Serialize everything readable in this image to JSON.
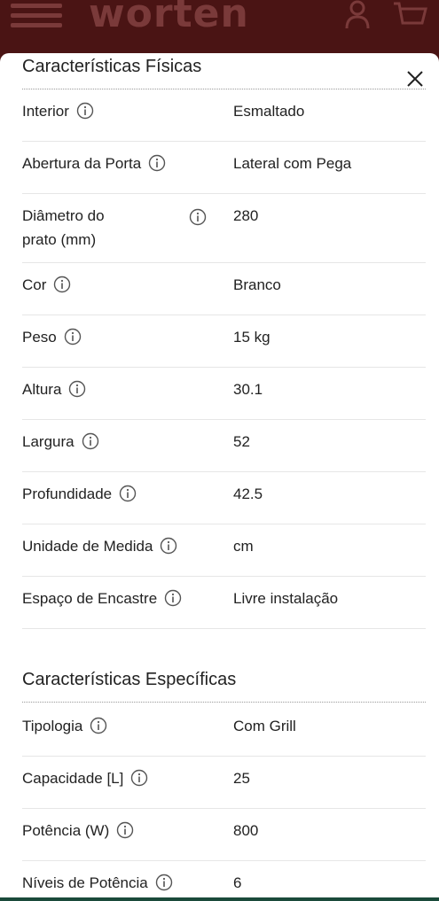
{
  "header": {
    "logo": "worten",
    "colors": {
      "bar": "#4a1414",
      "icons": "#7a3a3a"
    }
  },
  "sheet": {
    "close_label": "×",
    "sections": [
      {
        "title": "Características Físicas",
        "rows": [
          {
            "label": "Interior",
            "value": "Esmaltado"
          },
          {
            "label": "Abertura da Porta",
            "value": "Lateral com Pega"
          },
          {
            "label": "Diâmetro do prato (mm)",
            "label_line1": "Diâmetro do",
            "label_line2": "prato (mm)",
            "value": "280"
          },
          {
            "label": "Cor",
            "value": "Branco"
          },
          {
            "label": "Peso",
            "value": "15 kg"
          },
          {
            "label": "Altura",
            "value": "30.1"
          },
          {
            "label": "Largura",
            "value": "52"
          },
          {
            "label": "Profundidade",
            "value": "42.5"
          },
          {
            "label": "Unidade de Medida",
            "value": "cm"
          },
          {
            "label": "Espaço de Encastre",
            "value": "Livre instalação"
          }
        ]
      },
      {
        "title": "Características Específicas",
        "rows": [
          {
            "label": "Tipologia",
            "value": "Com Grill"
          },
          {
            "label": "Capacidade [L]",
            "value": "25"
          },
          {
            "label": "Potência (W)",
            "value": "800"
          },
          {
            "label": "Níveis de Potência",
            "value": "6"
          }
        ]
      }
    ]
  }
}
